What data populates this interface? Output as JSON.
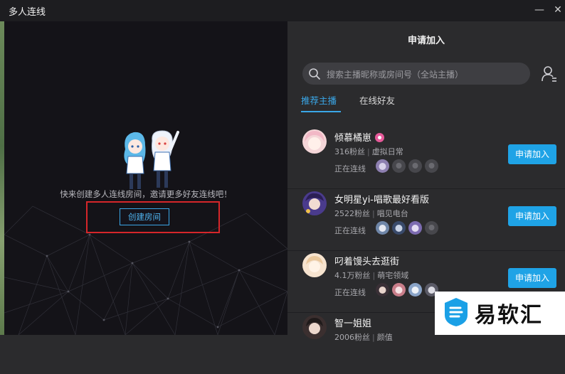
{
  "window": {
    "title": "多人连线",
    "minimize_icon": "minimize-icon",
    "close_icon": "close-icon"
  },
  "left": {
    "invite_text": "快来创建多人连线房间，邀请更多好友连线吧！",
    "create_button": "创建房间"
  },
  "right": {
    "title": "申请加入",
    "search_placeholder": "搜索主播昵称或房间号（全站主播）",
    "tabs": [
      {
        "label": "推荐主播",
        "active": true
      },
      {
        "label": "在线好友",
        "active": false
      }
    ],
    "online_label": "正在连线",
    "join_label": "申请加入",
    "streamers": [
      {
        "name": "倾慕橘崽",
        "fans": "316粉丝",
        "category": "虚拟日常",
        "badge": "pink-badge"
      },
      {
        "name": "女明星yi-唱歌最好看版",
        "fans": "2522粉丝",
        "category": "唱见电台"
      },
      {
        "name": "叼着馒头去逛街",
        "fans": "4.1万粉丝",
        "category": "萌宅领域"
      },
      {
        "name": "智一姐姐",
        "fans": "2006粉丝",
        "category": "颜值"
      }
    ]
  },
  "watermark": {
    "text": "易软汇"
  },
  "colors": {
    "accent": "#1fa3e6",
    "highlight": "#d6262a",
    "panel": "#2b2b2d",
    "canvas": "#141318"
  }
}
